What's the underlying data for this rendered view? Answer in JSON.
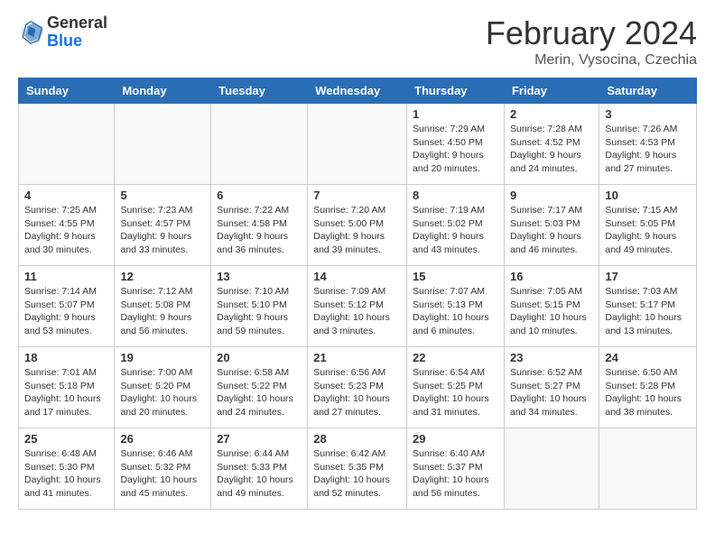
{
  "header": {
    "logo_general": "General",
    "logo_blue": "Blue",
    "month_year": "February 2024",
    "location": "Merin, Vysocina, Czechia"
  },
  "days_of_week": [
    "Sunday",
    "Monday",
    "Tuesday",
    "Wednesday",
    "Thursday",
    "Friday",
    "Saturday"
  ],
  "weeks": [
    [
      {
        "day": "",
        "info": ""
      },
      {
        "day": "",
        "info": ""
      },
      {
        "day": "",
        "info": ""
      },
      {
        "day": "",
        "info": ""
      },
      {
        "day": "1",
        "info": "Sunrise: 7:29 AM\nSunset: 4:50 PM\nDaylight: 9 hours\nand 20 minutes."
      },
      {
        "day": "2",
        "info": "Sunrise: 7:28 AM\nSunset: 4:52 PM\nDaylight: 9 hours\nand 24 minutes."
      },
      {
        "day": "3",
        "info": "Sunrise: 7:26 AM\nSunset: 4:53 PM\nDaylight: 9 hours\nand 27 minutes."
      }
    ],
    [
      {
        "day": "4",
        "info": "Sunrise: 7:25 AM\nSunset: 4:55 PM\nDaylight: 9 hours\nand 30 minutes."
      },
      {
        "day": "5",
        "info": "Sunrise: 7:23 AM\nSunset: 4:57 PM\nDaylight: 9 hours\nand 33 minutes."
      },
      {
        "day": "6",
        "info": "Sunrise: 7:22 AM\nSunset: 4:58 PM\nDaylight: 9 hours\nand 36 minutes."
      },
      {
        "day": "7",
        "info": "Sunrise: 7:20 AM\nSunset: 5:00 PM\nDaylight: 9 hours\nand 39 minutes."
      },
      {
        "day": "8",
        "info": "Sunrise: 7:19 AM\nSunset: 5:02 PM\nDaylight: 9 hours\nand 43 minutes."
      },
      {
        "day": "9",
        "info": "Sunrise: 7:17 AM\nSunset: 5:03 PM\nDaylight: 9 hours\nand 46 minutes."
      },
      {
        "day": "10",
        "info": "Sunrise: 7:15 AM\nSunset: 5:05 PM\nDaylight: 9 hours\nand 49 minutes."
      }
    ],
    [
      {
        "day": "11",
        "info": "Sunrise: 7:14 AM\nSunset: 5:07 PM\nDaylight: 9 hours\nand 53 minutes."
      },
      {
        "day": "12",
        "info": "Sunrise: 7:12 AM\nSunset: 5:08 PM\nDaylight: 9 hours\nand 56 minutes."
      },
      {
        "day": "13",
        "info": "Sunrise: 7:10 AM\nSunset: 5:10 PM\nDaylight: 9 hours\nand 59 minutes."
      },
      {
        "day": "14",
        "info": "Sunrise: 7:09 AM\nSunset: 5:12 PM\nDaylight: 10 hours\nand 3 minutes."
      },
      {
        "day": "15",
        "info": "Sunrise: 7:07 AM\nSunset: 5:13 PM\nDaylight: 10 hours\nand 6 minutes."
      },
      {
        "day": "16",
        "info": "Sunrise: 7:05 AM\nSunset: 5:15 PM\nDaylight: 10 hours\nand 10 minutes."
      },
      {
        "day": "17",
        "info": "Sunrise: 7:03 AM\nSunset: 5:17 PM\nDaylight: 10 hours\nand 13 minutes."
      }
    ],
    [
      {
        "day": "18",
        "info": "Sunrise: 7:01 AM\nSunset: 5:18 PM\nDaylight: 10 hours\nand 17 minutes."
      },
      {
        "day": "19",
        "info": "Sunrise: 7:00 AM\nSunset: 5:20 PM\nDaylight: 10 hours\nand 20 minutes."
      },
      {
        "day": "20",
        "info": "Sunrise: 6:58 AM\nSunset: 5:22 PM\nDaylight: 10 hours\nand 24 minutes."
      },
      {
        "day": "21",
        "info": "Sunrise: 6:56 AM\nSunset: 5:23 PM\nDaylight: 10 hours\nand 27 minutes."
      },
      {
        "day": "22",
        "info": "Sunrise: 6:54 AM\nSunset: 5:25 PM\nDaylight: 10 hours\nand 31 minutes."
      },
      {
        "day": "23",
        "info": "Sunrise: 6:52 AM\nSunset: 5:27 PM\nDaylight: 10 hours\nand 34 minutes."
      },
      {
        "day": "24",
        "info": "Sunrise: 6:50 AM\nSunset: 5:28 PM\nDaylight: 10 hours\nand 38 minutes."
      }
    ],
    [
      {
        "day": "25",
        "info": "Sunrise: 6:48 AM\nSunset: 5:30 PM\nDaylight: 10 hours\nand 41 minutes."
      },
      {
        "day": "26",
        "info": "Sunrise: 6:46 AM\nSunset: 5:32 PM\nDaylight: 10 hours\nand 45 minutes."
      },
      {
        "day": "27",
        "info": "Sunrise: 6:44 AM\nSunset: 5:33 PM\nDaylight: 10 hours\nand 49 minutes."
      },
      {
        "day": "28",
        "info": "Sunrise: 6:42 AM\nSunset: 5:35 PM\nDaylight: 10 hours\nand 52 minutes."
      },
      {
        "day": "29",
        "info": "Sunrise: 6:40 AM\nSunset: 5:37 PM\nDaylight: 10 hours\nand 56 minutes."
      },
      {
        "day": "",
        "info": ""
      },
      {
        "day": "",
        "info": ""
      }
    ]
  ]
}
